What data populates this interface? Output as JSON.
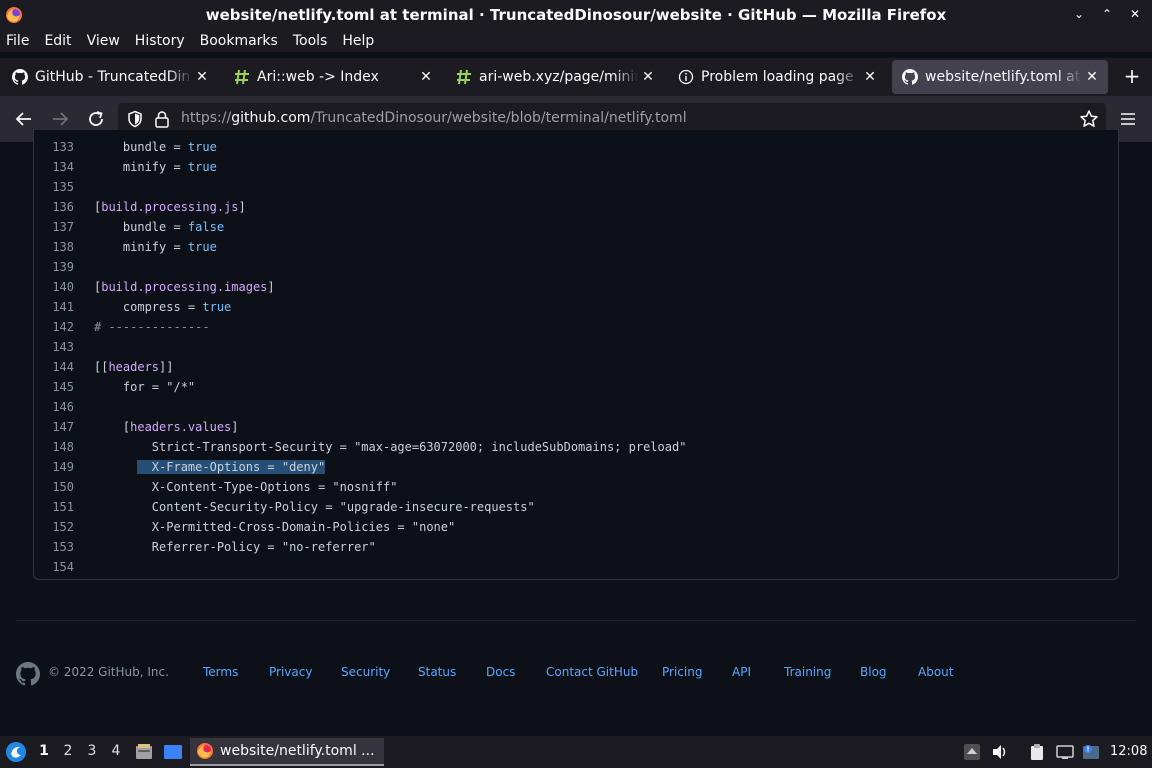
{
  "window": {
    "title": "website/netlify.toml at terminal · TruncatedDinosour/website · GitHub — Mozilla Firefox"
  },
  "menubar": {
    "items": [
      "File",
      "Edit",
      "View",
      "History",
      "Bookmarks",
      "Tools",
      "Help"
    ]
  },
  "tabs": [
    {
      "label": "GitHub - TruncatedDinosour/website",
      "icon": "github-icon",
      "active": false
    },
    {
      "label": "Ari::web -> Index",
      "icon": "hash-icon",
      "active": false
    },
    {
      "label": "ari-web.xyz/page/minimal",
      "icon": "hash-icon",
      "active": false
    },
    {
      "label": "Problem loading page",
      "icon": "info-icon",
      "active": false
    },
    {
      "label": "website/netlify.toml at terminal",
      "icon": "github-icon",
      "active": true
    }
  ],
  "urlbar": {
    "prefix": "https://",
    "host": "github.com",
    "path": "/TruncatedDinosour/website/blob/terminal/netlify.toml"
  },
  "code": {
    "lines": [
      {
        "n": "133",
        "text": "    bundle = true"
      },
      {
        "n": "134",
        "text": "    minify = true"
      },
      {
        "n": "135",
        "text": ""
      },
      {
        "n": "136",
        "text": "[build.processing.js]"
      },
      {
        "n": "137",
        "text": "    bundle = false"
      },
      {
        "n": "138",
        "text": "    minify = true"
      },
      {
        "n": "139",
        "text": ""
      },
      {
        "n": "140",
        "text": "[build.processing.images]"
      },
      {
        "n": "141",
        "text": "    compress = true"
      },
      {
        "n": "142",
        "text": "# --------------"
      },
      {
        "n": "143",
        "text": ""
      },
      {
        "n": "144",
        "text": "[[headers]]"
      },
      {
        "n": "145",
        "text": "    for = \"/*\""
      },
      {
        "n": "146",
        "text": ""
      },
      {
        "n": "147",
        "text": "    [headers.values]"
      },
      {
        "n": "148",
        "text": "        Strict-Transport-Security = \"max-age=63072000; includeSubDomains; preload\""
      },
      {
        "n": "149",
        "text": "        X-Frame-Options = \"deny\""
      },
      {
        "n": "150",
        "text": "        X-Content-Type-Options = \"nosniff\""
      },
      {
        "n": "151",
        "text": "        Content-Security-Policy = \"upgrade-insecure-requests\""
      },
      {
        "n": "152",
        "text": "        X-Permitted-Cross-Domain-Policies = \"none\""
      },
      {
        "n": "153",
        "text": "        Referrer-Policy = \"no-referrer\""
      },
      {
        "n": "154",
        "text": ""
      }
    ],
    "selected_line": "149"
  },
  "footer": {
    "copyright": "© 2022 GitHub, Inc.",
    "links": [
      "Terms",
      "Privacy",
      "Security",
      "Status",
      "Docs",
      "Contact GitHub",
      "Pricing",
      "API",
      "Training",
      "Blog",
      "About"
    ]
  },
  "taskbar": {
    "workspaces": [
      "1",
      "2",
      "3",
      "4"
    ],
    "active_workspace": "1",
    "task_label": "website/netlify.toml ...",
    "clock": "12:08"
  },
  "colors": {
    "page_bg": "#0d1117",
    "chrome_bg": "#1c1b22",
    "link": "#58a6ff",
    "code_keyword": "#79c0ff",
    "code_section": "#d2a8ff",
    "selection": "#264f78"
  }
}
